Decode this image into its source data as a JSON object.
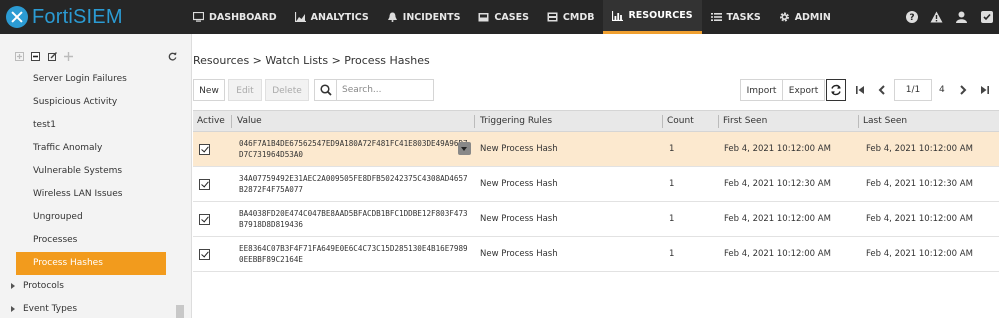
{
  "app": {
    "name": "FortiSIEM"
  },
  "nav": {
    "items": [
      {
        "label": "DASHBOARD",
        "icon": "monitor-icon"
      },
      {
        "label": "ANALYTICS",
        "icon": "area-chart-icon"
      },
      {
        "label": "INCIDENTS",
        "icon": "bell-icon"
      },
      {
        "label": "CASES",
        "icon": "inbox-icon"
      },
      {
        "label": "CMDB",
        "icon": "database-icon"
      },
      {
        "label": "RESOURCES",
        "icon": "bar-chart-icon",
        "active": true
      },
      {
        "label": "TASKS",
        "icon": "tasks-list-icon"
      },
      {
        "label": "ADMIN",
        "icon": "gear-icon"
      }
    ],
    "right_icons": [
      "help-icon",
      "warning-icon",
      "user-icon",
      "settings-icon"
    ],
    "active_color": "#f0a030"
  },
  "sidebar": {
    "items": [
      {
        "label": "Server Login Failures"
      },
      {
        "label": "Suspicious Activity"
      },
      {
        "label": "test1"
      },
      {
        "label": "Traffic Anomaly"
      },
      {
        "label": "Vulnerable Systems"
      },
      {
        "label": "Wireless LAN Issues"
      },
      {
        "label": "Ungrouped"
      },
      {
        "label": "Processes"
      },
      {
        "label": "Process Hashes",
        "selected": true
      }
    ],
    "groups": [
      {
        "label": "Protocols"
      },
      {
        "label": "Event Types"
      }
    ],
    "selected_color": "#f29b1d"
  },
  "main": {
    "breadcrumb": "Resources > Watch Lists > Process Hashes",
    "toolbar": {
      "new_label": "New",
      "edit_label": "Edit",
      "delete_label": "Delete",
      "search_placeholder": "Search...",
      "import_label": "Import",
      "export_label": "Export",
      "page_value": "1/1",
      "total": "4"
    },
    "table": {
      "columns": [
        "Active",
        "Value",
        "Triggering Rules",
        "Count",
        "First Seen",
        "Last Seen"
      ],
      "rows": [
        {
          "active": true,
          "value": "046F7A1B4DE67562547ED9A180A72F481FC41E803DE49A96D7D7C731964D53A0",
          "rule": "New Process Hash",
          "count": "1",
          "first_seen": "Feb 4, 2021 10:12:00 AM",
          "last_seen": "Feb 4, 2021 10:12:00 AM",
          "selected": true
        },
        {
          "active": true,
          "value": "34A07759492E31AEC2A009505FE8DFB50242375C4308AD4657B2872F4F75A077",
          "rule": "New Process Hash",
          "count": "1",
          "first_seen": "Feb 4, 2021 10:12:30 AM",
          "last_seen": "Feb 4, 2021 10:12:30 AM"
        },
        {
          "active": true,
          "value": "BA4038FD20E474C047BE8AAD5BFACDB1BFC1DDBE12F803F473B7918D8D819436",
          "rule": "New Process Hash",
          "count": "1",
          "first_seen": "Feb 4, 2021 10:12:00 AM",
          "last_seen": "Feb 4, 2021 10:12:00 AM"
        },
        {
          "active": true,
          "value": "EE8364C07B3F4F71FA649E0E6C4C73C15D285130E4B16E79890EEBBF89C2164E",
          "rule": "New Process Hash",
          "count": "1",
          "first_seen": "Feb 4, 2021 10:12:00 AM",
          "last_seen": "Feb 4, 2021 10:12:00 AM"
        }
      ],
      "selected_row_color": "#fce9cf"
    }
  }
}
